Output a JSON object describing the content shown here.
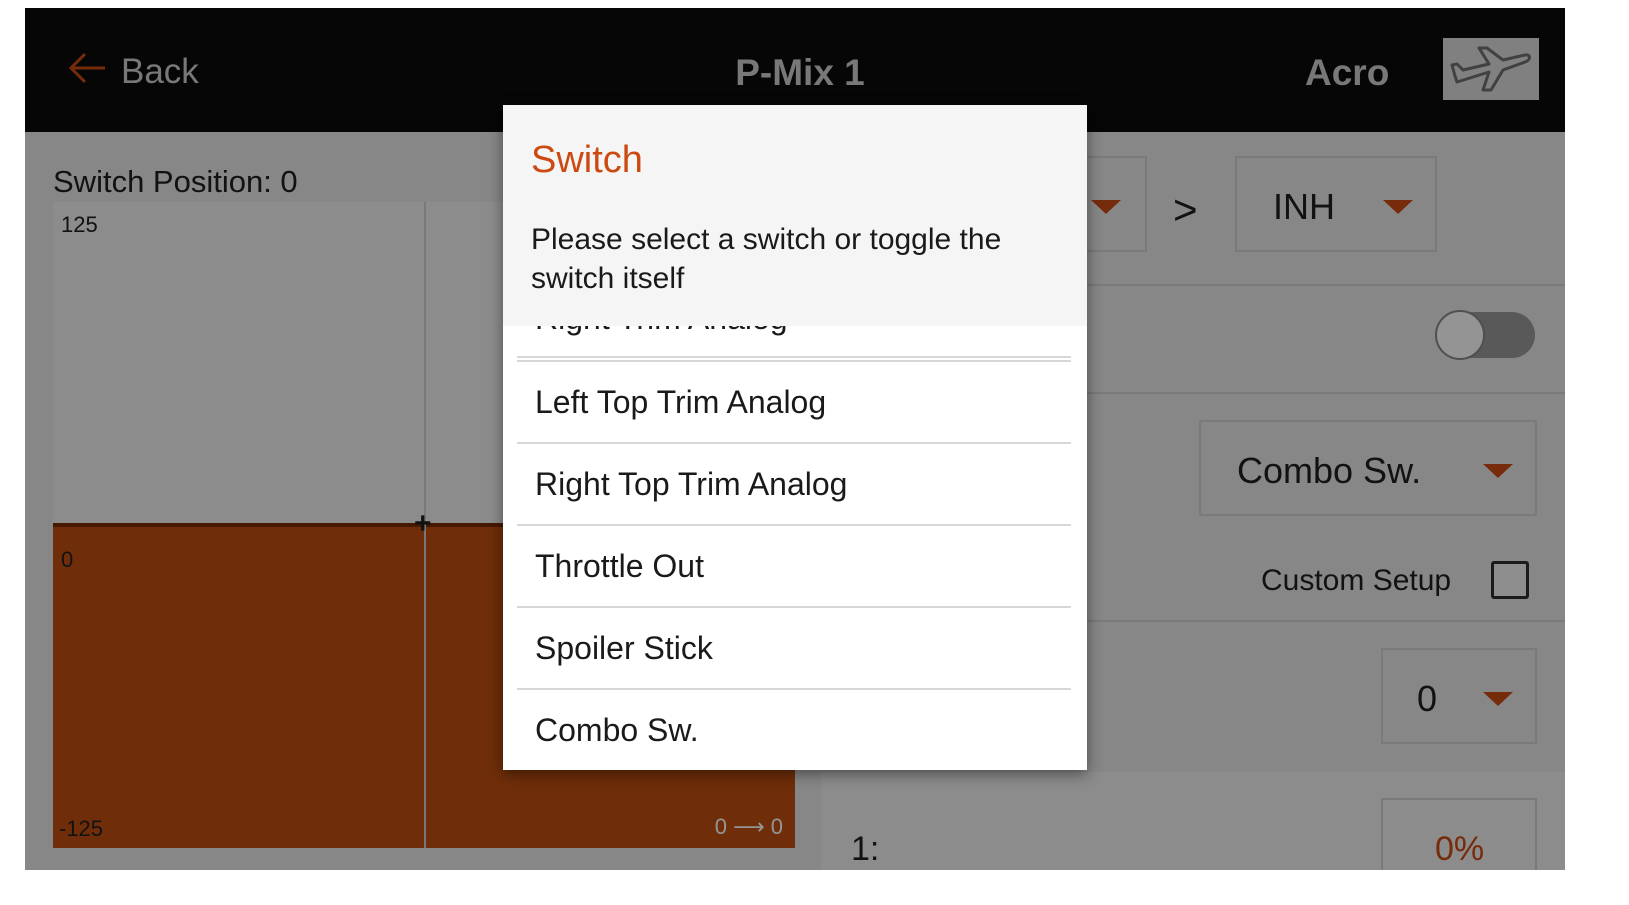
{
  "header": {
    "back_label": "Back",
    "title": "P-Mix 1",
    "mode": "Acro"
  },
  "graph": {
    "switch_position_label": "Switch Position: 0",
    "y_max": "125",
    "y_zero": "0",
    "y_min": "-125",
    "readout_from": "0",
    "readout_to": "0",
    "fill_level_percent": 50
  },
  "right_panel": {
    "inh_value": "INH",
    "separator": ">",
    "combo_value": "Combo Sw.",
    "custom_setup_label": "Custom Setup",
    "custom_setup_checked": false,
    "position_value": "0",
    "point_label": "1:",
    "point_value": "0%",
    "toggle_on": false
  },
  "dialog": {
    "title": "Switch",
    "message": "Please select a switch or toggle the switch itself",
    "partial_option": "Right Trim Analog",
    "options": [
      "Left Top Trim Analog",
      "Right Top Trim Analog",
      "Throttle Out",
      "Spoiler Stick",
      "Combo Sw."
    ]
  },
  "colors": {
    "accent": "#cc4a12",
    "topbar": "#0c0c0c",
    "graph_fill": "#c05010"
  },
  "icons": {
    "back": "back-arrow-icon",
    "model": "airplane-icon",
    "dropdown": "caret-down-icon"
  }
}
